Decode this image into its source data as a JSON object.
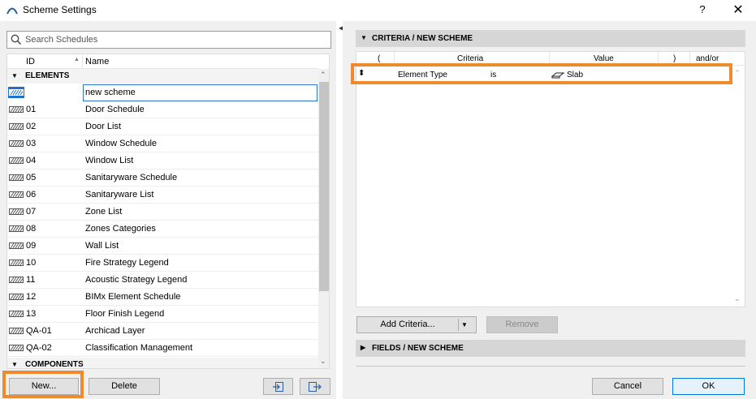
{
  "window": {
    "title": "Scheme Settings",
    "help": "?",
    "close": "✕",
    "app_icon": "archicad-arc-icon"
  },
  "search": {
    "placeholder": "Search Schedules",
    "icon": "search-icon"
  },
  "list": {
    "columns": {
      "id": "ID",
      "name": "Name"
    },
    "groups": {
      "elements": "ELEMENTS",
      "components": "COMPONENTS"
    },
    "editing_value": "new scheme",
    "rows": [
      {
        "id": "01",
        "name": "Door Schedule"
      },
      {
        "id": "02",
        "name": "Door List"
      },
      {
        "id": "03",
        "name": "Window Schedule"
      },
      {
        "id": "04",
        "name": "Window List"
      },
      {
        "id": "05",
        "name": "Sanitaryware Schedule"
      },
      {
        "id": "06",
        "name": "Sanitaryware List"
      },
      {
        "id": "07",
        "name": "Zone List"
      },
      {
        "id": "08",
        "name": "Zones Categories"
      },
      {
        "id": "09",
        "name": "Wall List"
      },
      {
        "id": "10",
        "name": "Fire Strategy Legend"
      },
      {
        "id": "11",
        "name": "Acoustic Strategy Legend"
      },
      {
        "id": "12",
        "name": "BIMx Element Schedule"
      },
      {
        "id": "13",
        "name": "Floor Finish Legend"
      },
      {
        "id": "QA-01",
        "name": "Archicad Layer"
      },
      {
        "id": "QA-02",
        "name": "Classification Management"
      }
    ]
  },
  "left_buttons": {
    "new": "New...",
    "delete": "Delete"
  },
  "criteria": {
    "section_label": "CRITERIA /  NEW SCHEME",
    "headers": {
      "open_paren": "(",
      "criteria": "Criteria",
      "value": "Value",
      "close_paren": ")",
      "andor": "and/or"
    },
    "row": {
      "element": "Element Type",
      "operator": "is",
      "value": "Slab"
    }
  },
  "criteria_buttons": {
    "add": "Add Criteria...",
    "remove": "Remove"
  },
  "fields": {
    "section_label": "FIELDS /  NEW SCHEME"
  },
  "dialog_buttons": {
    "cancel": "Cancel",
    "ok": "OK"
  },
  "colors": {
    "highlight": "#f08a2c",
    "selection": "#1e73c8",
    "ok_border": "#0078d7"
  }
}
